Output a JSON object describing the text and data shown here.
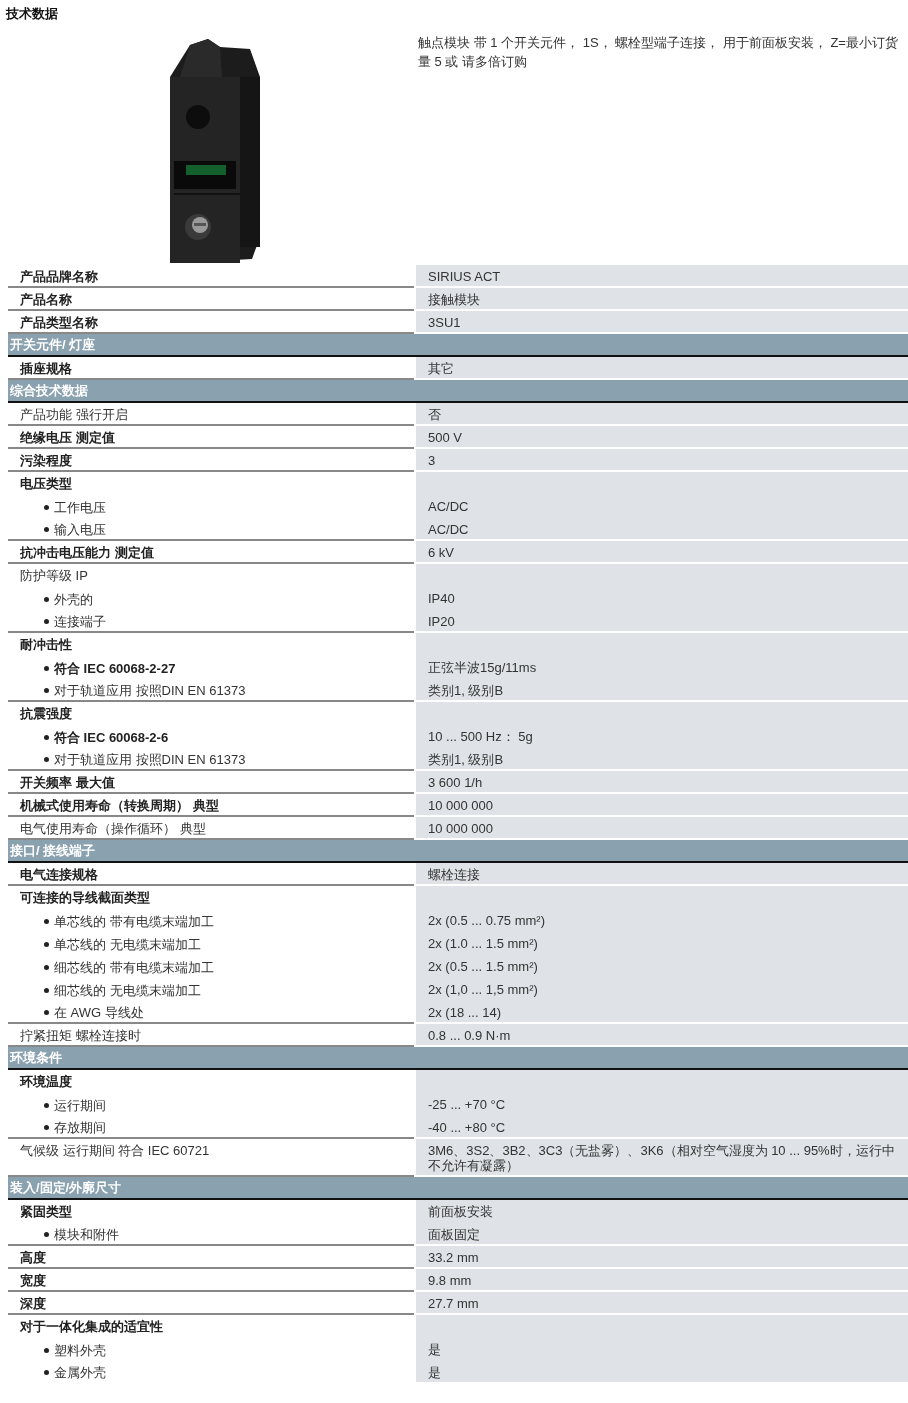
{
  "title": "技术数据",
  "product": {
    "description": "触点模块 带 1 个开关元件， 1S， 螺栓型端子连接， 用于前面板安装， Z=最小订货量 5 或 请多倍订购"
  },
  "sections": [
    {
      "rows": [
        {
          "label": "产品品牌名称",
          "bold": true,
          "value": "SIRIUS ACT"
        },
        {
          "label": "产品名称",
          "bold": true,
          "value": "接触模块"
        },
        {
          "label": "产品类型名称",
          "bold": true,
          "value": "3SU1"
        }
      ]
    },
    {
      "heading": "开关元件/ 灯座",
      "rows": [
        {
          "label": "插座规格",
          "bold": true,
          "value": "其它"
        }
      ]
    },
    {
      "heading": "综合技术数据",
      "rows": [
        {
          "label": "产品功能 强行开启",
          "bold": false,
          "value": "否"
        },
        {
          "label": "绝缘电压 测定值",
          "bold": true,
          "value": "500 V"
        },
        {
          "label": "污染程度",
          "bold": true,
          "value": "3"
        },
        {
          "label": "电压类型",
          "bold": true,
          "items": [
            {
              "label": "工作电压",
              "bold": false,
              "value": "AC/DC"
            },
            {
              "label": "输入电压",
              "bold": false,
              "value": "AC/DC"
            }
          ]
        },
        {
          "label": "抗冲击电压能力 测定值",
          "bold": true,
          "value": "6 kV"
        },
        {
          "label": "防护等级 IP",
          "bold": false,
          "items": [
            {
              "label": "外壳的",
              "bold": false,
              "value": "IP40"
            },
            {
              "label": "连接端子",
              "bold": false,
              "value": "IP20"
            }
          ]
        },
        {
          "label": "耐冲击性",
          "bold": true,
          "items": [
            {
              "label": "符合 IEC 60068-2-27",
              "bold": true,
              "value": "正弦半波15g/11ms"
            },
            {
              "label": "对于轨道应用 按照DIN EN 61373",
              "bold": false,
              "value": "类别1, 级别B"
            }
          ]
        },
        {
          "label": "抗震强度",
          "bold": true,
          "items": [
            {
              "label": "符合 IEC 60068-2-6",
              "bold": true,
              "value": "10 ... 500 Hz： 5g"
            },
            {
              "label": "对于轨道应用 按照DIN EN 61373",
              "bold": false,
              "value": "类别1, 级别B"
            }
          ]
        },
        {
          "label": "开关频率 最大值",
          "bold": true,
          "value": "3 600 1/h"
        },
        {
          "label": "机械式使用寿命（转换周期） 典型",
          "bold": true,
          "value": "10 000 000"
        },
        {
          "label": "电气使用寿命（操作循环） 典型",
          "bold": false,
          "value": "10 000 000"
        }
      ]
    },
    {
      "heading": "接口/ 接线端子",
      "rows": [
        {
          "label": "电气连接规格",
          "bold": true,
          "value": "螺栓连接"
        },
        {
          "label": "可连接的导线截面类型",
          "bold": true,
          "items": [
            {
              "label": "单芯线的 带有电缆末端加工",
              "bold": false,
              "value": "2x (0.5 ... 0.75 mm²)"
            },
            {
              "label": "单芯线的 无电缆末端加工",
              "bold": false,
              "value": "2x (1.0 ... 1.5 mm²)"
            },
            {
              "label": "细芯线的 带有电缆末端加工",
              "bold": false,
              "value": "2x (0.5 ... 1.5 mm²)"
            },
            {
              "label": "细芯线的 无电缆末端加工",
              "bold": false,
              "value": "2x (1,0 ... 1,5 mm²)"
            },
            {
              "label": "在 AWG 导线处",
              "bold": false,
              "value": "2x (18 ... 14)"
            }
          ]
        },
        {
          "label": "拧紧扭矩 螺栓连接时",
          "bold": false,
          "value": "0.8 ... 0.9 N·m"
        }
      ]
    },
    {
      "heading": "环境条件",
      "rows": [
        {
          "label": "环境温度",
          "bold": true,
          "items": [
            {
              "label": "运行期间",
              "bold": false,
              "value": "-25 ... +70 °C"
            },
            {
              "label": "存放期间",
              "bold": false,
              "value": "-40 ... +80 °C"
            }
          ]
        },
        {
          "label": "气候级 运行期间 符合 IEC 60721",
          "bold": false,
          "value": "3M6、3S2、3B2、3C3（无盐雾）、3K6（相对空气湿度为 10 ... 95%时，运行中不允许有凝露）"
        }
      ]
    },
    {
      "heading": "装入/固定/外廓尺寸",
      "rows": [
        {
          "label": "紧固类型",
          "bold": true,
          "value": "前面板安装",
          "items": [
            {
              "label": "模块和附件",
              "bold": false,
              "value": "面板固定"
            }
          ]
        },
        {
          "label": "高度",
          "bold": true,
          "value": "33.2 mm"
        },
        {
          "label": "宽度",
          "bold": true,
          "value": "9.8 mm"
        },
        {
          "label": "深度",
          "bold": true,
          "value": "27.7 mm"
        },
        {
          "label": "对于一体化集成的适宜性",
          "bold": true,
          "items": [
            {
              "label": "塑料外壳",
              "bold": false,
              "value": "是"
            },
            {
              "label": "金属外壳",
              "bold": false,
              "value": "是"
            }
          ]
        }
      ]
    }
  ]
}
